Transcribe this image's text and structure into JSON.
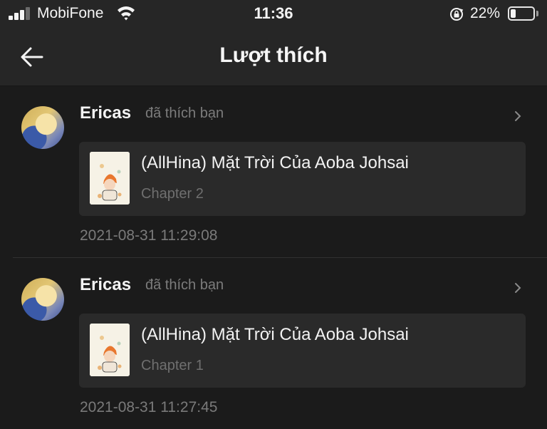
{
  "status_bar": {
    "carrier": "MobiFone",
    "time": "11:36",
    "battery_percent": "22%",
    "battery_level": 0.22,
    "signal_bars_active": 3,
    "signal_bars_total": 4,
    "icons": [
      "signal-icon",
      "wifi-icon",
      "rotation-lock-icon",
      "battery-icon"
    ]
  },
  "nav": {
    "title": "Lượt thích",
    "back_icon": "back-arrow-icon"
  },
  "notifications": [
    {
      "user": "Ericas",
      "action": "đã thích bạn",
      "story_title": "(AllHina) Mặt Trời Của Aoba Johsai",
      "chapter": "Chapter 2",
      "timestamp": "2021-08-31 11:29:08"
    },
    {
      "user": "Ericas",
      "action": "đã thích bạn",
      "story_title": "(AllHina) Mặt Trời Của Aoba Johsai",
      "chapter": "Chapter 1",
      "timestamp": "2021-08-31 11:27:45"
    }
  ],
  "colors": {
    "background": "#1b1b1b",
    "header": "#262626",
    "card": "#2a2a2a",
    "muted_text": "#7a7a7a"
  }
}
